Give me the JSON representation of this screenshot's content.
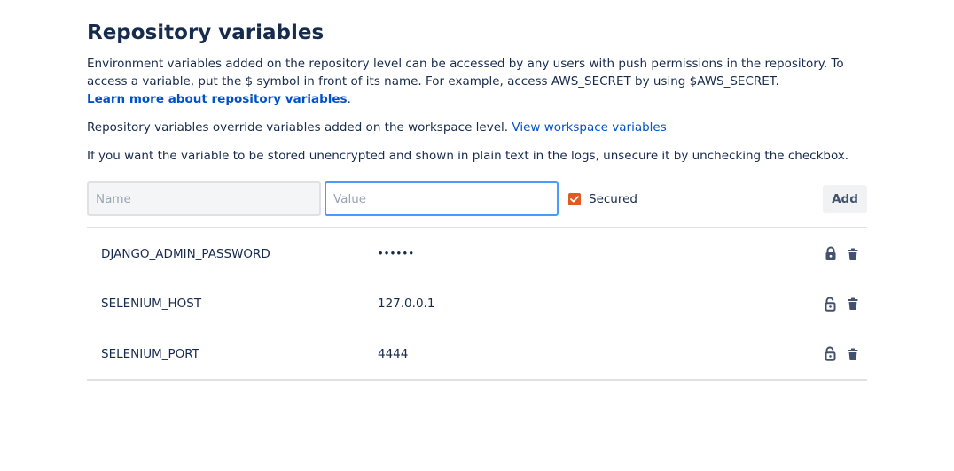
{
  "section": {
    "title": "Repository variables",
    "description_1": "Environment variables added on the repository level can be accessed by any users with push permissions in the repository. To access a variable, put the $ symbol in front of its name. For example, access AWS_SECRET by using $AWS_SECRET.",
    "learn_more_link": "Learn more about repository variables",
    "learn_more_suffix": ".",
    "description_2": "Repository variables override variables added on the workspace level. ",
    "view_workspace_link": "View workspace variables",
    "description_3": "If you want the variable to be stored unencrypted and shown in plain text in the logs, unsecure it by unchecking the checkbox."
  },
  "form": {
    "name_placeholder": "Name",
    "name_value": "",
    "value_placeholder": "Value",
    "value_value": "",
    "secured_label": "Secured",
    "secured_checked": true,
    "add_label": "Add"
  },
  "variables": [
    {
      "name": "DJANGO_ADMIN_PASSWORD",
      "value": "••••••",
      "secured": true,
      "lock_icon": "lock-icon",
      "delete_icon": "trash-icon"
    },
    {
      "name": "SELENIUM_HOST",
      "value": "127.0.0.1",
      "secured": false,
      "lock_icon": "unlock-icon",
      "delete_icon": "trash-icon"
    },
    {
      "name": "SELENIUM_PORT",
      "value": "4444",
      "secured": false,
      "lock_icon": "unlock-icon",
      "delete_icon": "trash-icon"
    }
  ],
  "colors": {
    "text": "#172b4d",
    "link": "#0052cc",
    "checkbox": "#de5a28",
    "focus_border": "#4c9aff",
    "icon": "#42526e"
  }
}
